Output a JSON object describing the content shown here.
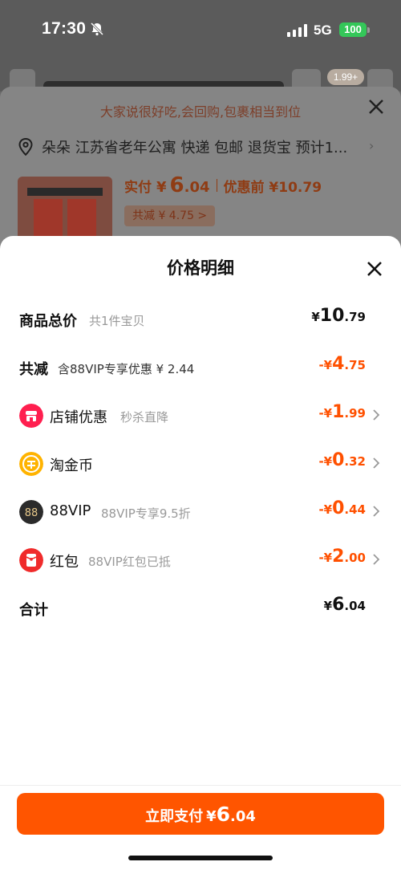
{
  "status_bar": {
    "time": "17:30",
    "network": "5G",
    "battery": "100"
  },
  "background_page": {
    "badge": "1.99+",
    "review_banner": "大家说很好吃,会回购,包裹相当到位",
    "address": "朵朵 江苏省老年公寓  快递 包邮 退货宝 预计1...",
    "paid": {
      "label": "实付",
      "currency": "¥",
      "int": "6",
      "dec": ".04",
      "before_label": "优惠前 ¥10.79"
    },
    "reduce_chip": "共减 ¥ 4.75 >"
  },
  "sheet": {
    "title": "价格明细",
    "rows": [
      {
        "label": "商品总价",
        "sub": "共1件宝贝",
        "prefix": "",
        "currency": "¥",
        "int": "10",
        "dec": ".79"
      },
      {
        "label": "共减",
        "sub": "含88VIP专享优惠 ¥ 2.44",
        "prefix": "-",
        "currency": "¥",
        "int": "4",
        "dec": ".75"
      },
      {
        "label": "店铺优惠",
        "sub": "秒杀直降",
        "prefix": "-",
        "currency": "¥",
        "int": "1",
        "dec": ".99"
      },
      {
        "label": "淘金币",
        "sub": "",
        "prefix": "-",
        "currency": "¥",
        "int": "0",
        "dec": ".32"
      },
      {
        "label": "88VIP",
        "sub": "88VIP专享9.5折",
        "prefix": "-",
        "currency": "¥",
        "int": "0",
        "dec": ".44"
      },
      {
        "label": "红包",
        "sub": "88VIP红包已抵",
        "prefix": "-",
        "currency": "¥",
        "int": "2",
        "dec": ".00"
      },
      {
        "label": "合计",
        "sub": "",
        "prefix": "",
        "currency": "¥",
        "int": "6",
        "dec": ".04"
      }
    ],
    "icons": {
      "shop": "#ff1f4f",
      "coin": "#ffb300",
      "vip": "#2b2b2b",
      "redpacket": "#f02b2b",
      "accent": "#ff5000"
    },
    "vip_icon_text": "88",
    "pay_button": {
      "label": "立即支付",
      "currency": "¥",
      "int": "6",
      "dec": ".04"
    }
  }
}
